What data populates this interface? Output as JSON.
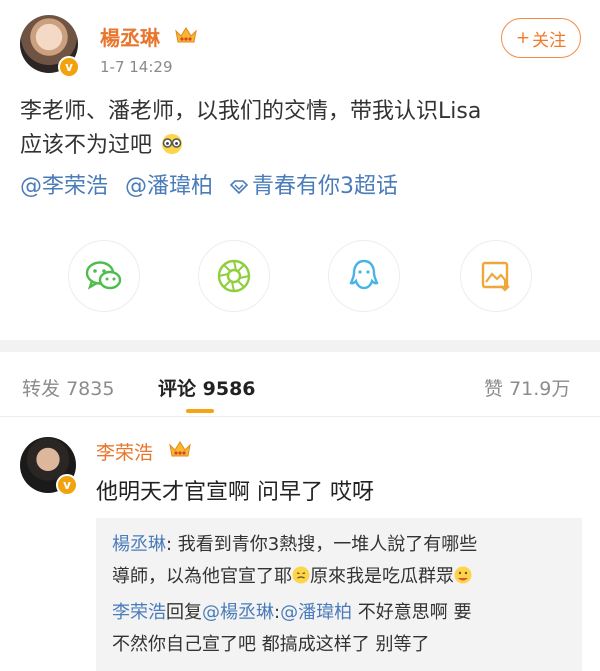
{
  "post": {
    "author": "楊丞琳",
    "time": "1-7 14:29",
    "follow_label": "关注",
    "follow_plus": "+",
    "content_line1": "李老师、潘老师，以我们的交情，带我认识Lisa",
    "content_line2": "应该不为过吧",
    "mention1": "@李荣浩",
    "mention2": "@潘瑋柏",
    "supertopic": "青春有你3超话",
    "verified_badge": "v"
  },
  "share_icons": [
    "wechat-icon",
    "moments-icon",
    "qq-icon",
    "save-image-icon"
  ],
  "tabs": {
    "repost_label": "转发",
    "repost_count": "7835",
    "comment_label": "评论",
    "comment_count": "9586",
    "like_label": "赞",
    "like_count": "71.9万"
  },
  "comment": {
    "author": "李荣浩",
    "text": "他明天才官宣啊 问早了 哎呀",
    "verified_badge": "v"
  },
  "replies": {
    "r1_name": "楊丞琳",
    "r1_text_a": ": 我看到青你3熱搜，一堆人說了有哪些",
    "r1_text_b": "導師，以為他官宣了耶",
    "r1_text_c": "原來我是吃瓜群眾",
    "r2_name": "李荣浩",
    "r2_reply": "回复",
    "r2_mention": "@楊丞琳",
    "r2_colon": ":",
    "r2_mention2": "@潘瑋柏",
    "r2_text_a": " 不好意思啊 要",
    "r2_text_b": "不然你自己宣了吧 都搞成这样了 别等了"
  },
  "colors": {
    "accent_orange": "#e8762d",
    "link_blue": "#4a7cba",
    "tab_underline": "#f7a316",
    "verified_gold": "#f2a20c"
  }
}
